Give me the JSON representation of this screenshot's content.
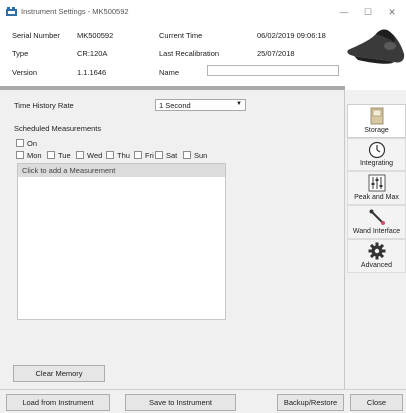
{
  "window": {
    "title": "Instrument Settings - MK500592",
    "minimize_glyph": "—",
    "maximize_glyph": "☐",
    "close_glyph": "✕"
  },
  "info": {
    "serial_label": "Serial Number",
    "serial_value": "MK500592",
    "type_label": "Type",
    "type_value": "CR:120A",
    "version_label": "Version",
    "version_value": "1.1.1646",
    "current_time_label": "Current Time",
    "current_time_value": "06/02/2019 09:06:18",
    "last_calibration_label": "Last Recalibration",
    "last_calibration_value": "25/07/2018",
    "name_label": "Name",
    "name_value": ""
  },
  "settings": {
    "time_history_label": "Time History Rate",
    "time_history_value": "1 Second",
    "scheduled_label": "Scheduled Measurements",
    "on_label": "On",
    "days": [
      "Mon",
      "Tue",
      "Wed",
      "Thu",
      "Fri",
      "Sat",
      "Sun"
    ],
    "add_measurement_label": "Click to add a Measurement",
    "clear_memory_label": "Clear Memory"
  },
  "sidebar": {
    "items": [
      {
        "label": "Storage",
        "icon": "storage-icon"
      },
      {
        "label": "Integrating",
        "icon": "clock-icon"
      },
      {
        "label": "Peak and Max",
        "icon": "sliders-icon"
      },
      {
        "label": "Wand Interface",
        "icon": "wand-icon"
      },
      {
        "label": "Advanced",
        "icon": "gear-icon"
      }
    ]
  },
  "footer": {
    "load_label": "Load from Instrument",
    "save_label": "Save to Instrument",
    "backup_label": "Backup/Restore",
    "close_label": "Close"
  },
  "colors": {
    "divider": "#a9a9a9",
    "panel_bg": "#f0f0f0",
    "list_header_bg": "#dcdcdc"
  }
}
